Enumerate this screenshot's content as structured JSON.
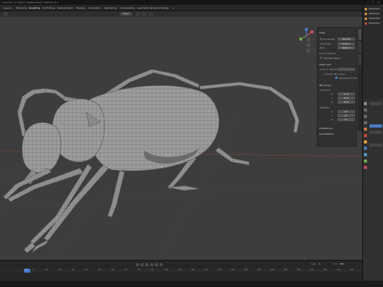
{
  "window": {
    "title": "C:/Users/.../longhorn-beetle.blend - Blender 4.1",
    "controls": [
      "—",
      "☐",
      "✕"
    ]
  },
  "menubar": {
    "tabs": [
      "Layout",
      "Modeling",
      "Sculpting",
      "UV Editing",
      "Texture Paint",
      "Shading",
      "Animation",
      "Rendering",
      "Compositing",
      "Geometry Nodes",
      "Scripting",
      "+"
    ],
    "active_tab": "Sculpting"
  },
  "viewport": {
    "mode_label": "Object",
    "background": "#3d3d3d",
    "mesh_color": "#9a9a9a",
    "wire_color": "#5c5c5c"
  },
  "npanel": {
    "section_view": "View",
    "focal_label": "Focal Length",
    "focal_value": "50 mm",
    "clip_start_label": "Clip Start",
    "clip_start_value": "0.01 m",
    "clip_end_label": "End",
    "clip_end_value": "1000 m",
    "local_camera_label": "Local Camera",
    "render_region_label": "Render Region",
    "section_view_lock": "View Lock",
    "lock_object_label": "Lock to Object",
    "lock_3d_cursor_label": "Lock to 3D Cursor",
    "lock_camera_label": "Camera to View",
    "section_3d_cursor": "3D Cursor",
    "location_label": "Location",
    "x_label": "X",
    "x_value": "0 m",
    "y_label": "Y",
    "y_value": "0 m",
    "z_label": "Z",
    "z_value": "0 m",
    "rotation_label": "Rotation",
    "rx_value": "0°",
    "ry_value": "0°",
    "rz_value": "0°",
    "section_collections": "Collections",
    "section_annotations": "Annotations"
  },
  "timeline": {
    "ticks": [
      "0",
      "10",
      "20",
      "30",
      "40",
      "50",
      "60",
      "70",
      "80",
      "90",
      "100",
      "110",
      "120",
      "130",
      "140",
      "150",
      "160",
      "170",
      "180",
      "190",
      "200",
      "210",
      "220",
      "230",
      "240",
      "250"
    ],
    "current_frame": "1",
    "start_label": "Start",
    "start_value": "1",
    "end_label": "End",
    "end_value": "250"
  }
}
